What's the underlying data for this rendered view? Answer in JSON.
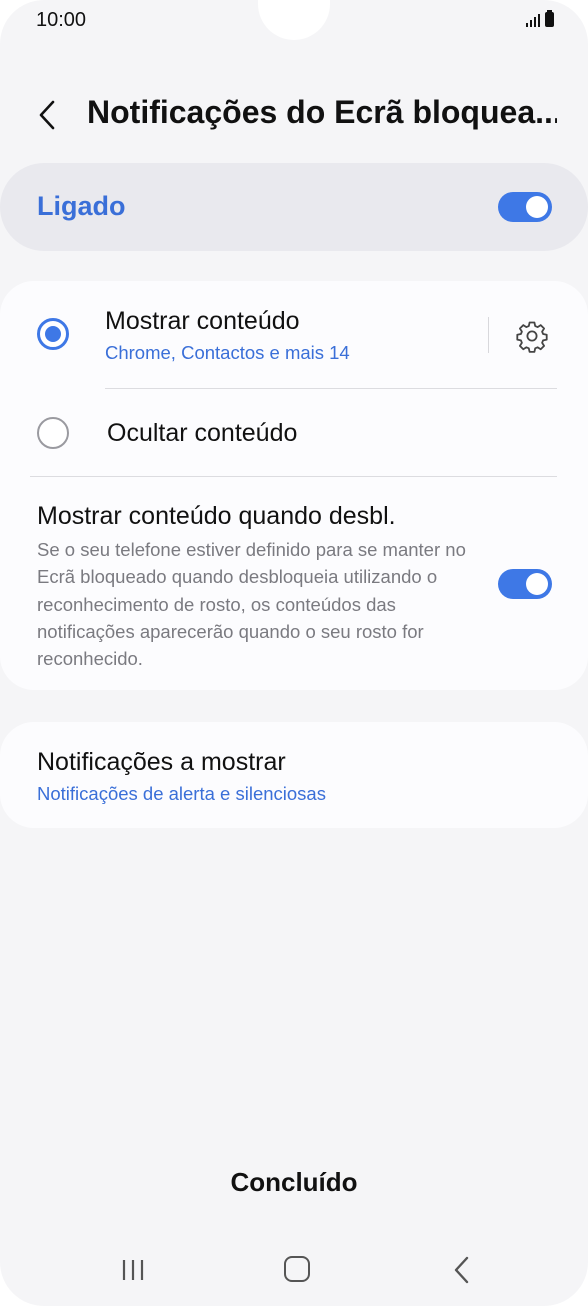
{
  "status_bar": {
    "time": "10:00",
    "signal_icon": "signal-icon",
    "battery_icon": "battery-icon"
  },
  "header": {
    "back_icon": "chevron-left-icon",
    "title": "Notificações do Ecrã bloquea..."
  },
  "master_toggle": {
    "label": "Ligado",
    "on": true
  },
  "options": {
    "show_content": {
      "title": "Mostrar conteúdo",
      "subtitle": "Chrome, Contactos e mais 14",
      "selected": true,
      "settings_icon": "gear-icon"
    },
    "hide_content": {
      "title": "Ocultar conteúdo",
      "selected": false
    },
    "show_when_unlocked": {
      "title": "Mostrar conteúdo quando desbl.",
      "description": "Se o seu telefone estiver definido para se manter no Ecrã bloqueado quando desbloqueia utilizando o reconhecimento de rosto, os conteúdos das notificações aparecerão quando o seu rosto for reconhecido.",
      "on": true
    }
  },
  "notifications_to_show": {
    "title": "Notificações a mostrar",
    "value": "Notificações de alerta e silenciosas"
  },
  "done_button": "Concluído",
  "colors": {
    "accent": "#3e78e6",
    "link": "#3a6fd8",
    "background": "#f5f5f7"
  },
  "nav_bar": {
    "recents_icon": "recents-icon",
    "home_icon": "home-icon",
    "back_icon": "back-icon"
  }
}
